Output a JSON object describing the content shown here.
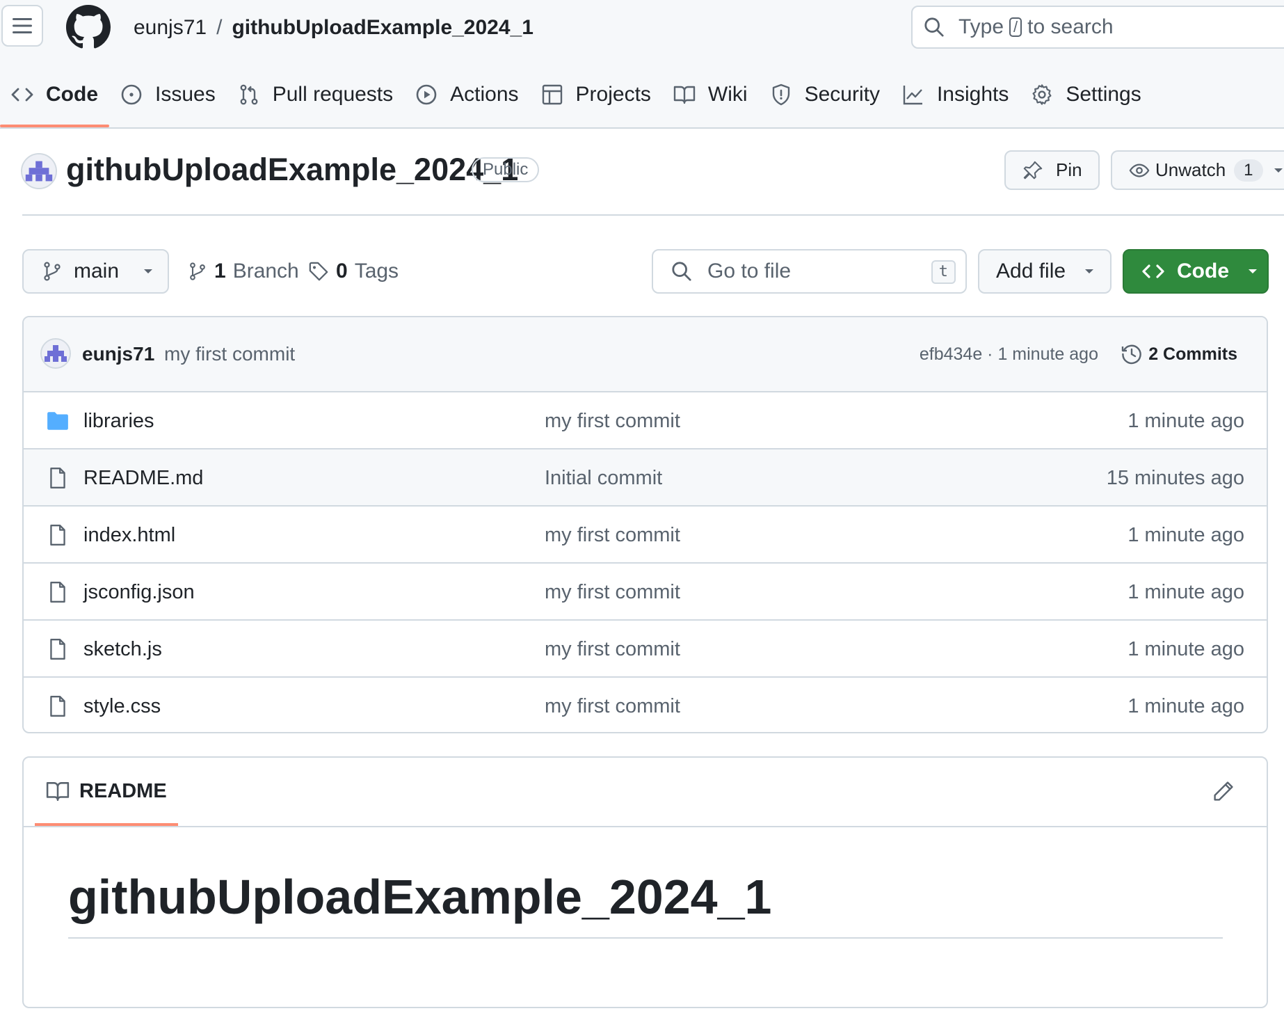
{
  "header": {
    "owner": "eunjs71",
    "separator": "/",
    "repo": "githubUploadExample_2024_1",
    "search": {
      "before": "Type",
      "key": "/",
      "after": "to search"
    }
  },
  "tabs": [
    {
      "label": "Code",
      "icon": "code-icon",
      "active": true
    },
    {
      "label": "Issues",
      "icon": "issue-opened-icon"
    },
    {
      "label": "Pull requests",
      "icon": "git-pull-request-icon"
    },
    {
      "label": "Actions",
      "icon": "play-icon"
    },
    {
      "label": "Projects",
      "icon": "table-icon"
    },
    {
      "label": "Wiki",
      "icon": "book-icon"
    },
    {
      "label": "Security",
      "icon": "shield-icon"
    },
    {
      "label": "Insights",
      "icon": "graph-icon"
    },
    {
      "label": "Settings",
      "icon": "gear-icon"
    }
  ],
  "repo": {
    "name": "githubUploadExample_2024_1",
    "visibility": "Public",
    "pin_label": "Pin",
    "unwatch_label": "Unwatch",
    "watch_count": "1"
  },
  "file_nav": {
    "branch": "main",
    "branch_count": "1",
    "branch_label": "Branch",
    "tag_count": "0",
    "tag_label": "Tags",
    "goto_placeholder": "Go to file",
    "goto_shortcut": "t",
    "add_file_label": "Add file",
    "code_label": "Code"
  },
  "latest_commit": {
    "author": "eunjs71",
    "message": "my first commit",
    "hash_time": "efb434e · 1 minute ago",
    "commits_label": "2 Commits"
  },
  "files": [
    {
      "name": "libraries",
      "type": "folder",
      "message": "my first commit",
      "age": "1 minute ago"
    },
    {
      "name": "README.md",
      "type": "file",
      "message": "Initial commit",
      "age": "15 minutes ago"
    },
    {
      "name": "index.html",
      "type": "file",
      "message": "my first commit",
      "age": "1 minute ago"
    },
    {
      "name": "jsconfig.json",
      "type": "file",
      "message": "my first commit",
      "age": "1 minute ago"
    },
    {
      "name": "sketch.js",
      "type": "file",
      "message": "my first commit",
      "age": "1 minute ago"
    },
    {
      "name": "style.css",
      "type": "file",
      "message": "my first commit",
      "age": "1 minute ago"
    }
  ],
  "readme": {
    "tab_label": "README",
    "heading": "githubUploadExample_2024_1"
  },
  "colors": {
    "accent_underline": "#fd8c73",
    "primary_button": "#2f8a3d",
    "folder": "#54aeff",
    "avatar": "#6e6fd6"
  }
}
